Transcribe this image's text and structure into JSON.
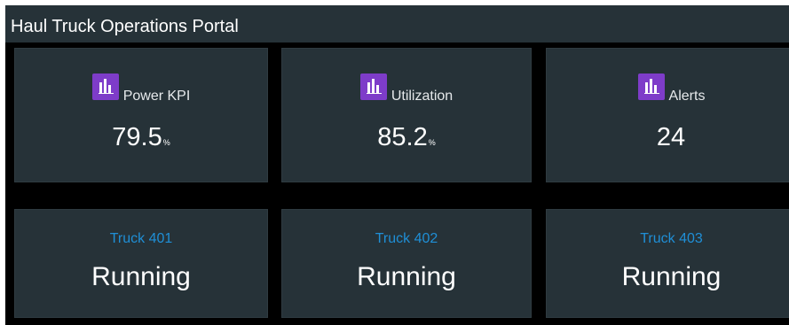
{
  "header": {
    "title": "Haul Truck Operations Portal"
  },
  "kpis": [
    {
      "label": "Power KPI",
      "value": "79.5",
      "unit": "%",
      "icon": "bar-chart-icon"
    },
    {
      "label": "Utilization",
      "value": "85.2",
      "unit": "%",
      "icon": "bar-chart-icon"
    },
    {
      "label": "Alerts",
      "value": "24",
      "unit": "",
      "icon": "bar-chart-icon"
    }
  ],
  "trucks": [
    {
      "name": "Truck 401",
      "status": "Running"
    },
    {
      "name": "Truck 402",
      "status": "Running"
    },
    {
      "name": "Truck 403",
      "status": "Running"
    }
  ],
  "colors": {
    "background": "#000000",
    "panel": "#263238",
    "icon_accent": "#7e3cc9",
    "truck_name": "#1f8fd6",
    "text": "#ffffff"
  }
}
